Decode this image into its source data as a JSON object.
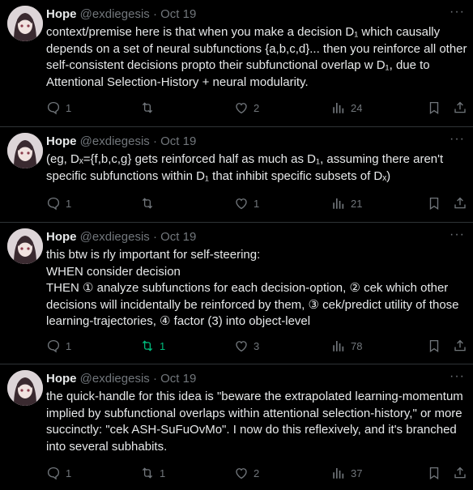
{
  "tweets": [
    {
      "name": "Hope",
      "handle": "@exdiegesis",
      "sep": "·",
      "date": "Oct 19",
      "text": "context/premise here is that when you make a decision D₁ which causally depends on a set of neural subfunctions {a,b,c,d}... then you reinforce all other self-consistent decisions propto their subfunctional overlap w D₁, due to Attentional Selection-History + neural modularity.",
      "replies": "1",
      "retweets": "",
      "likes": "2",
      "views": "24"
    },
    {
      "name": "Hope",
      "handle": "@exdiegesis",
      "sep": "·",
      "date": "Oct 19",
      "text": "(eg, Dₓ={f,b,c,g} gets reinforced half as much as D₁, assuming there aren't specific subfunctions within D₁ that inhibit specific subsets of Dₓ)",
      "replies": "1",
      "retweets": "",
      "likes": "1",
      "views": "21"
    },
    {
      "name": "Hope",
      "handle": "@exdiegesis",
      "sep": "·",
      "date": "Oct 19",
      "text": "this btw is rly important for self-steering:\nWHEN consider decision\nTHEN ① analyze subfunctions for each decision-option, ② cek which other decisions will incidentally be reinforced by them, ③ cek/predict utility of those learning-trajectories, ④ factor (3) into object-level",
      "replies": "1",
      "retweets": "1",
      "likes": "3",
      "views": "78"
    },
    {
      "name": "Hope",
      "handle": "@exdiegesis",
      "sep": "·",
      "date": "Oct 19",
      "text": "the quick-handle for this idea is \"beware the extrapolated learning-momentum implied by subfunctional overlaps within attentional selection-history,\" or more succinctly:  \"cek ASH-SuFuOvMo\".  I now do this reflexively, and it's branched into several subhabits.",
      "replies": "1",
      "retweets": "1",
      "likes": "2",
      "views": "37"
    }
  ],
  "colors": {
    "background": "#000000",
    "text": "#e7e9ea",
    "muted": "#71767b",
    "retweet_active": "#00ba7c"
  },
  "icons": {
    "more": "more-icon",
    "reply": "reply-icon",
    "retweet": "retweet-icon",
    "like": "heart-icon",
    "views": "views-icon",
    "bookmark": "bookmark-icon",
    "share": "share-icon"
  }
}
